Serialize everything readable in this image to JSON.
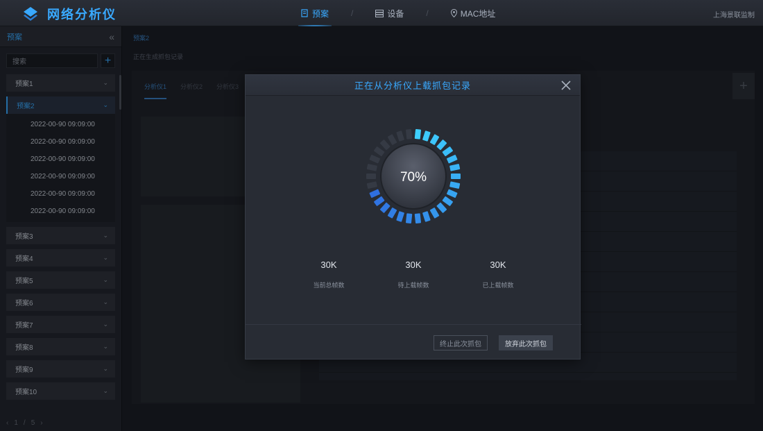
{
  "app": {
    "title": "网络分析仪",
    "org": "上海景联监制"
  },
  "topnav": [
    {
      "label": "预案",
      "icon": "document-icon",
      "active": true
    },
    {
      "label": "设备",
      "icon": "server-icon",
      "active": false
    },
    {
      "label": "MAC地址",
      "icon": "location-pin-icon",
      "active": false
    }
  ],
  "sidebar": {
    "title": "预案",
    "collapse_icon": "double-chevron-left-icon",
    "search_placeholder": "搜索",
    "plans": [
      {
        "label": "预案1"
      },
      {
        "label": "预案2",
        "expanded": true
      },
      {
        "label": "预案3"
      },
      {
        "label": "预案4"
      },
      {
        "label": "预案5"
      },
      {
        "label": "预案6"
      },
      {
        "label": "预案7"
      },
      {
        "label": "预案8"
      },
      {
        "label": "预案9"
      },
      {
        "label": "预案10"
      }
    ],
    "records": [
      "2022-00-90  09:09:00",
      "2022-00-90  09:09:00",
      "2022-00-90  09:09:00",
      "2022-00-90  09:09:00",
      "2022-00-90  09:09:00",
      "2022-00-90  09:09:00"
    ],
    "pager": {
      "current": "1",
      "sep": "/",
      "total": "5"
    }
  },
  "background": {
    "breadcrumb": "预案2",
    "subtitle": "正在生成抓包记录",
    "tabs": [
      "分析仪1",
      "分析仪2",
      "分析仪3"
    ]
  },
  "modal": {
    "title": "正在从分析仪上载抓包记录",
    "progress": 70,
    "progress_label": "70%",
    "stats": [
      {
        "value": "30K",
        "label": "当前总帧数"
      },
      {
        "value": "30K",
        "label": "待上载帧数"
      },
      {
        "value": "30K",
        "label": "已上载帧数"
      }
    ],
    "stop_label": "终止此次抓包",
    "abort_label": "放弃此次抓包",
    "colors": {
      "accent": "#39a9ff",
      "ring_start": "#2f6fe0",
      "ring_end": "#3ed0ff",
      "ring_empty": "#353a44"
    }
  }
}
